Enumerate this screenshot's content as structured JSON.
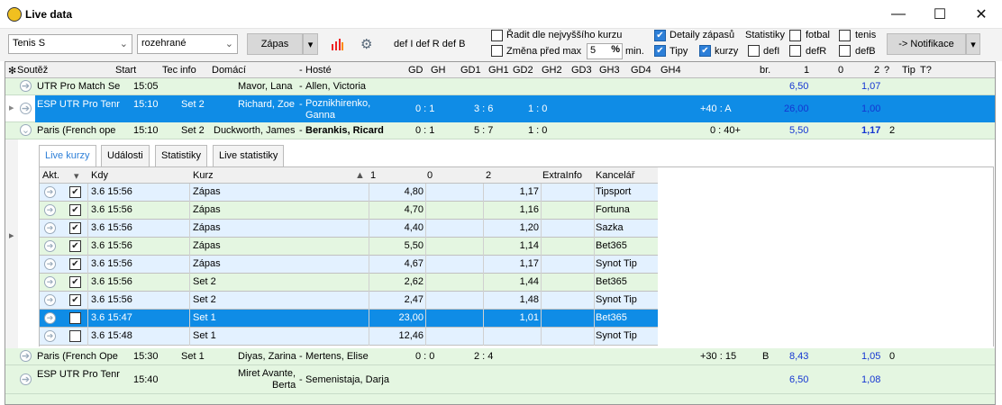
{
  "window": {
    "title": "Live data",
    "min": "—",
    "max": "☐",
    "close": "✕"
  },
  "toolbar": {
    "sport": "Tenis S",
    "state": "rozehrané",
    "type": "Zápas",
    "defs": "def I def R def B",
    "sort_best": "Řadit dle nejvyššího kurzu",
    "change_before": "Změna před max",
    "minutes_value": "5",
    "min_label": "min.",
    "details": "Detaily zápasů",
    "stats": "Statistiky",
    "football": "fotbal",
    "tennis": "tenis",
    "tips": "Tipy",
    "odds": "kurzy",
    "defl": "defI",
    "defr": "defR",
    "defb": "defB",
    "notif": "-> Notifikace"
  },
  "grid": {
    "headers": [
      "Soutěž",
      "Start",
      "Tec",
      "info",
      "Domácí",
      "-",
      "Hosté",
      "GD",
      "GH",
      "GD1",
      "GH1",
      "GD2",
      "GH2",
      "GD3",
      "GH3",
      "GD4",
      "GH4",
      "br.",
      "1",
      "0",
      "2",
      "?",
      "Tip",
      "T?"
    ],
    "rows": [
      {
        "comp": "UTR Pro Match Se",
        "start": "15:05",
        "info": "",
        "home": "Mavor, Lana",
        "away": "Allen, Victoria",
        "s1": "",
        "s2": "",
        "s3": "",
        "pts": "",
        "br": "",
        "o1": "6,50",
        "o2": "1,07",
        "tip": ""
      },
      {
        "comp": "ESP UTR Pro Tenr",
        "start": "15:10",
        "info": "Set 2",
        "home": "Richard, Zoe",
        "away1": "Poznikhirenko,",
        "away2": "Ganna",
        "s1": "0 : 1",
        "s2": "3 : 6",
        "s3": "1 : 0",
        "pts": "+40 : A",
        "br": "",
        "o1": "26,00",
        "o2": "1,00",
        "tip": ""
      },
      {
        "comp": "Paris (French ope",
        "start": "15:10",
        "info": "Set 2",
        "home": "Duckworth, James",
        "away": "Berankis, Ricard",
        "s1": "0 : 1",
        "s2": "5 : 7",
        "s3": "1 : 0",
        "pts": "0 : 40+",
        "br": "",
        "o1": "5,50",
        "o2": "1,17",
        "tip": "2"
      },
      {
        "comp": "Paris (French Ope",
        "start": "15:30",
        "info": "Set 1",
        "home": "Diyas, Zarina",
        "away": "Mertens, Elise",
        "s1": "0 : 0",
        "s2": "2 : 4",
        "s3": "",
        "pts": "+30 : 15",
        "br": "B",
        "o1": "8,43",
        "o2": "1,05",
        "tip": "0"
      },
      {
        "comp": "ESP UTR Pro Tenr",
        "start": "15:40",
        "info": "",
        "home1": "Miret Avante,",
        "home2": "Berta",
        "away": "Semenistaja, Darja",
        "o1": "6,50",
        "o2": "1,08"
      }
    ]
  },
  "detail": {
    "tabs": [
      "Live kurzy",
      "Události",
      "Statistiky",
      "Live statistiky"
    ],
    "headers": [
      "Akt.",
      "Kdy",
      "Kurz",
      "1",
      "0",
      "2",
      "ExtraInfo",
      "Kancelář"
    ],
    "rows": [
      {
        "kdy": "3.6 15:56",
        "kurz": "Zápas",
        "o1": "4,80",
        "o2": "1,17",
        "kanc": "Tipsport",
        "chk": "✔"
      },
      {
        "kdy": "3.6 15:56",
        "kurz": "Zápas",
        "o1": "4,70",
        "o2": "1,16",
        "kanc": "Fortuna",
        "chk": "✔"
      },
      {
        "kdy": "3.6 15:56",
        "kurz": "Zápas",
        "o1": "4,40",
        "o2": "1,20",
        "kanc": "Sazka",
        "chk": "✔"
      },
      {
        "kdy": "3.6 15:56",
        "kurz": "Zápas",
        "o1": "5,50",
        "o2": "1,14",
        "kanc": "Bet365",
        "chk": "✔"
      },
      {
        "kdy": "3.6 15:56",
        "kurz": "Zápas",
        "o1": "4,67",
        "o2": "1,17",
        "kanc": "Synot Tip",
        "chk": "✔"
      },
      {
        "kdy": "3.6 15:56",
        "kurz": "Set 2",
        "o1": "2,62",
        "o2": "1,44",
        "kanc": "Bet365",
        "chk": "✔"
      },
      {
        "kdy": "3.6 15:56",
        "kurz": "Set 2",
        "o1": "2,47",
        "o2": "1,48",
        "kanc": "Synot Tip",
        "chk": "✔"
      },
      {
        "kdy": "3.6 15:47",
        "kurz": "Set 1",
        "o1": "23,00",
        "o2": "1,01",
        "kanc": "Bet365",
        "chk": ""
      },
      {
        "kdy": "3.6 15:48",
        "kurz": "Set 1",
        "o1": "12,46",
        "o2": "",
        "kanc": "Synot Tip",
        "chk": ""
      }
    ]
  }
}
